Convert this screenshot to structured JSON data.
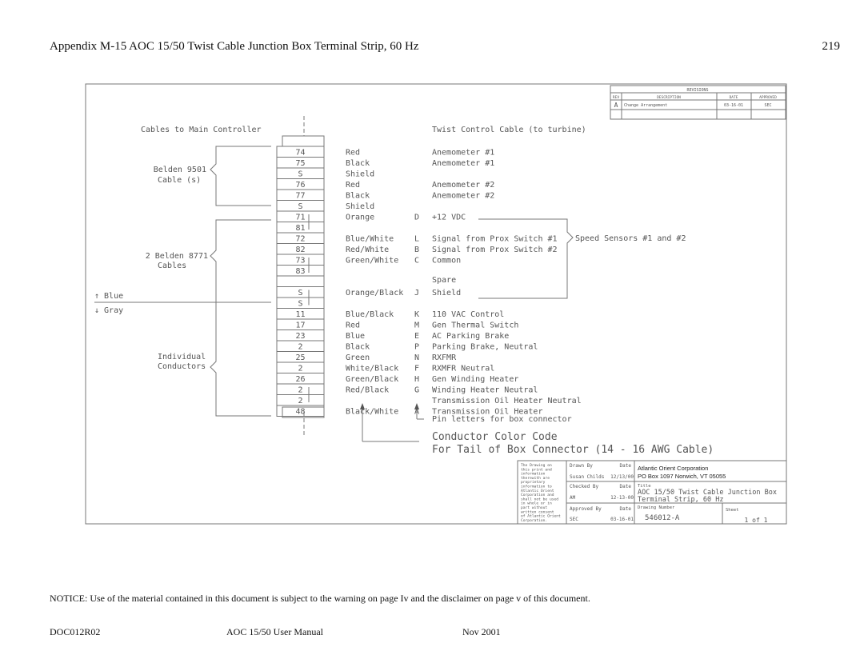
{
  "page": {
    "header": "Appendix M-15  AOC 15/50 Twist Cable Junction Box Terminal Strip, 60 Hz",
    "page_number": "219",
    "notice": "NOTICE:    Use of the material contained in this document is subject to the warning on page Iv and the disclaimer on page v of this document.",
    "footer": {
      "doc_id": "DOC012R02",
      "manual": "AOC 15/50 User Manual",
      "date": "Nov 2001"
    }
  },
  "revisions": {
    "title": "REVISIONS",
    "headers": [
      "REV",
      "DESCRIPTION",
      "DATE",
      "APPROVED"
    ],
    "rows": [
      {
        "rev": "A",
        "description": "Change Arrangement",
        "date": "03-16-01",
        "approved": "SEC"
      }
    ]
  },
  "diagram": {
    "left_heading": "Cables to Main Controller",
    "right_heading": "Twist Control Cable (to turbine)",
    "group_labels": {
      "belden9501": [
        "Belden 9501",
        "Cable (s)"
      ],
      "belden8771": [
        "2 Belden 8771",
        "Cables"
      ],
      "individual": [
        "Individual",
        "Conductors"
      ]
    },
    "blue_label": "↑ Blue",
    "gray_label": "↓ Gray",
    "speed_sensors": "Speed Sensors #1 and #2",
    "pin_note": "Pin letters for box connector",
    "color_code_title": "Conductor Color Code",
    "color_code_subtitle": "For Tail of Box Connector (14 - 16 AWG Cable)",
    "terminals": [
      {
        "num": "74",
        "color": "Red",
        "pin": "",
        "desc": "Anemometer #1"
      },
      {
        "num": "75",
        "color": "Black",
        "pin": "",
        "desc": "Anemometer #1"
      },
      {
        "num": "S",
        "color": "Shield",
        "pin": "",
        "desc": ""
      },
      {
        "num": "76",
        "color": "Red",
        "pin": "",
        "desc": "Anemometer #2"
      },
      {
        "num": "77",
        "color": "Black",
        "pin": "",
        "desc": "Anemometer #2"
      },
      {
        "num": "S",
        "color": "Shield",
        "pin": "",
        "desc": ""
      },
      {
        "num": "71",
        "color": "Orange",
        "pin": "D",
        "desc": "+12 VDC"
      },
      {
        "num": "81",
        "color": "",
        "pin": "",
        "desc": ""
      },
      {
        "num": "72",
        "color": "Blue/White",
        "pin": "L",
        "desc": "Signal from Prox Switch #1"
      },
      {
        "num": "82",
        "color": "Red/White",
        "pin": "B",
        "desc": "Signal from Prox Switch #2"
      },
      {
        "num": "73",
        "color": "Green/White",
        "pin": "C",
        "desc": "Common"
      },
      {
        "num": "83",
        "color": "",
        "pin": "",
        "desc": ""
      },
      {
        "num": "",
        "color": "",
        "pin": "",
        "desc": "Spare"
      },
      {
        "num": "S",
        "color": "Orange/Black",
        "pin": "J",
        "desc": "Shield"
      },
      {
        "num": "S",
        "color": "",
        "pin": "",
        "desc": ""
      },
      {
        "num": "11",
        "color": "Blue/Black",
        "pin": "K",
        "desc": "110 VAC Control"
      },
      {
        "num": "17",
        "color": "Red",
        "pin": "M",
        "desc": "Gen Thermal Switch"
      },
      {
        "num": "23",
        "color": "Blue",
        "pin": "E",
        "desc": "AC Parking Brake"
      },
      {
        "num": "2",
        "color": "Black",
        "pin": "P",
        "desc": "Parking Brake, Neutral"
      },
      {
        "num": "25",
        "color": "Green",
        "pin": "N",
        "desc": "RXFMR"
      },
      {
        "num": "2",
        "color": "White/Black",
        "pin": "F",
        "desc": "RXMFR Neutral"
      },
      {
        "num": "26",
        "color": "Green/Black",
        "pin": "H",
        "desc": "Gen Winding Heater"
      },
      {
        "num": "2",
        "color": "Red/Black",
        "pin": "G",
        "desc": "Winding Heater Neutral"
      },
      {
        "num": "2",
        "color": "",
        "pin": "",
        "desc": "Transmission Oil Heater Neutral"
      },
      {
        "num": "48",
        "color": "Black/White",
        "pin": "A",
        "desc": "Transmission Oil Heater"
      }
    ]
  },
  "title_block": {
    "proprietary": [
      "The Drawing on",
      "this print and",
      "information",
      "therewith are",
      "proprietary",
      "information to",
      "Atlantic Orient",
      "Corporation and",
      "shall not be used",
      "in whole or in",
      "part without",
      "written consent",
      "of Atlantic Orient",
      "Corporation."
    ],
    "drawn_by_label": "Drawn By",
    "date_label": "Date",
    "drawn_by": "Susan Childs",
    "drawn_date": "12/13/00",
    "checked_by_label": "Checked By",
    "checked_by": "AM",
    "checked_date": "12-13-00",
    "approved_by_label": "Approved By",
    "approved_by": "SEC",
    "approved_date": "03-16-01",
    "company": "Atlantic Orient Corporation",
    "address": "PO Box 1097 Norwich, VT 05055",
    "title_label": "Title",
    "title_line1": "AOC 15/50 Twist Cable Junction Box",
    "title_line2": "Terminal Strip, 60 Hz",
    "drawing_number_label": "Drawing Number",
    "drawing_number": "546012-A",
    "sheet_label": "Sheet",
    "sheet": "1 of 1"
  }
}
